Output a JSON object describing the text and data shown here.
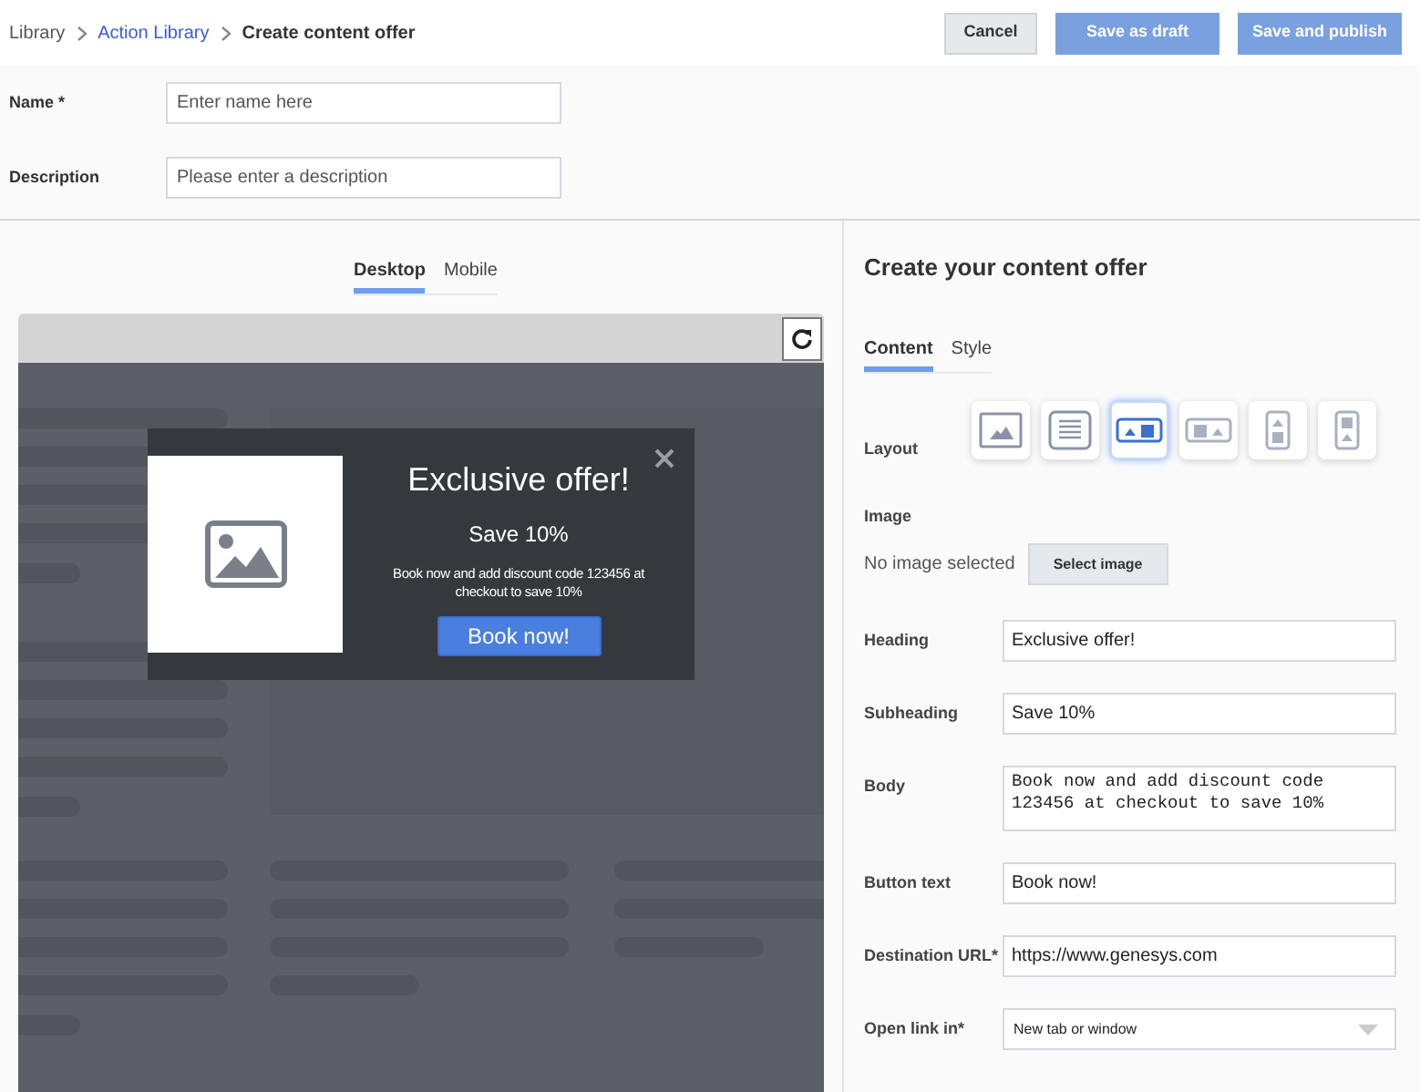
{
  "breadcrumb": [
    {
      "label": "Library",
      "kind": "plain"
    },
    {
      "label": "Action Library",
      "kind": "link"
    },
    {
      "label": "Create content offer",
      "kind": "current"
    }
  ],
  "actions": [
    {
      "label": "Cancel",
      "kind": "secondary"
    },
    {
      "label": "Save as draft",
      "kind": "primary"
    },
    {
      "label": "Save and publish",
      "kind": "primary"
    }
  ],
  "form": [
    {
      "label": "Name *",
      "placeholder": "Enter name here"
    },
    {
      "label": "Description",
      "placeholder": "Please enter a description"
    }
  ],
  "preview": {
    "tabs": [
      {
        "label": "Desktop",
        "selected": true
      },
      {
        "label": "Mobile",
        "selected": false
      }
    ],
    "popup": {
      "heading": "Exclusive offer!",
      "subheading": "Save 10%",
      "body": "Book now and add discount code 123456 at checkout to save 10%",
      "button": "Book now!"
    }
  },
  "editor": {
    "title": "Create your content offer",
    "tabs": [
      {
        "label": "Content",
        "selected": true
      },
      {
        "label": "Style",
        "selected": false
      }
    ],
    "layout": {
      "label": "Layout",
      "options": [
        {
          "kind": "image",
          "selected": false
        },
        {
          "kind": "text",
          "selected": false
        },
        {
          "kind": "image-left",
          "selected": true
        },
        {
          "kind": "image-right",
          "selected": false
        },
        {
          "kind": "image-top",
          "selected": false
        },
        {
          "kind": "image-bottom",
          "selected": false
        }
      ]
    },
    "image": {
      "label": "Image",
      "status": "No image selected",
      "button": "Select image"
    },
    "fields": [
      {
        "label": "Heading",
        "value": "Exclusive offer!",
        "kind": "text"
      },
      {
        "label": "Subheading",
        "value": "Save 10%",
        "kind": "text"
      },
      {
        "label": "Body",
        "value": "Book now and add discount code 123456 at checkout to save 10%",
        "kind": "textarea"
      },
      {
        "label": "Button text",
        "value": "Book now!",
        "kind": "text"
      },
      {
        "label": "Destination URL*",
        "value": "https://www.genesys.com",
        "kind": "text"
      },
      {
        "label": "Open link in*",
        "value": "New tab or window",
        "kind": "select"
      }
    ]
  }
}
